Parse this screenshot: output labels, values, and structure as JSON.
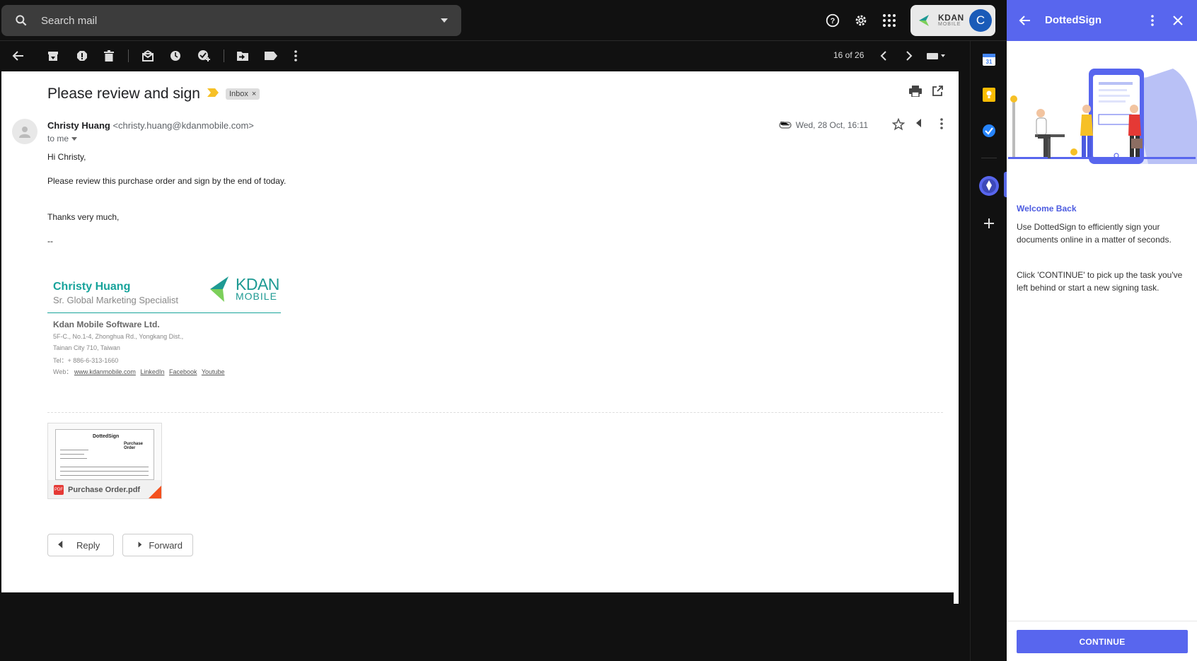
{
  "search": {
    "placeholder": "Search mail"
  },
  "account": {
    "logo_text": "KDAN",
    "logo_sub": "MOBILE",
    "avatar_initial": "C"
  },
  "toolbar": {
    "counter": "16 of 26"
  },
  "email": {
    "subject": "Please review and sign",
    "label": "Inbox",
    "sender_name": "Christy Huang",
    "sender_email": "<christy.huang@kdanmobile.com>",
    "recipient": "to me",
    "date": "Wed, 28 Oct, 16:11",
    "body": {
      "greeting": "Hi Christy,",
      "line1": "Please review this purchase order and sign by the end of today.",
      "thanks": "Thanks very much,",
      "dashes": "--"
    },
    "signature": {
      "name": "Christy Huang",
      "title": "Sr. Global Marketing Specialist",
      "logo_text": "KDAN",
      "logo_sub": "MOBILE",
      "company": "Kdan Mobile Software Ltd.",
      "address1": "5F-C., No.1-4, Zhonghua Rd., Yongkang Dist.,",
      "address2": "Tainan City 710, Taiwan",
      "tel": "Tel：+ 886-6-313-1660",
      "web_label": "Web：",
      "links": [
        "www.kdanmobile.com",
        "LinkedIn",
        "Facebook",
        "Youtube"
      ]
    },
    "attachment": {
      "filename": "Purchase Order.pdf",
      "type_label": "PDF",
      "thumb_title": "DottedSign",
      "thumb_heading": "Purchase Order"
    },
    "reply_label": "Reply",
    "forward_label": "Forward"
  },
  "panel": {
    "title": "DottedSign",
    "welcome": "Welcome Back",
    "text1": "Use DottedSign to efficiently sign your documents online in a matter of seconds.",
    "text2": "Click 'CONTINUE' to pick up the task you've left behind or start a new signing task.",
    "continue_label": "CONTINUE"
  },
  "colors": {
    "accent": "#5866ee",
    "signature_teal": "#17a39b",
    "background": "#111111"
  }
}
